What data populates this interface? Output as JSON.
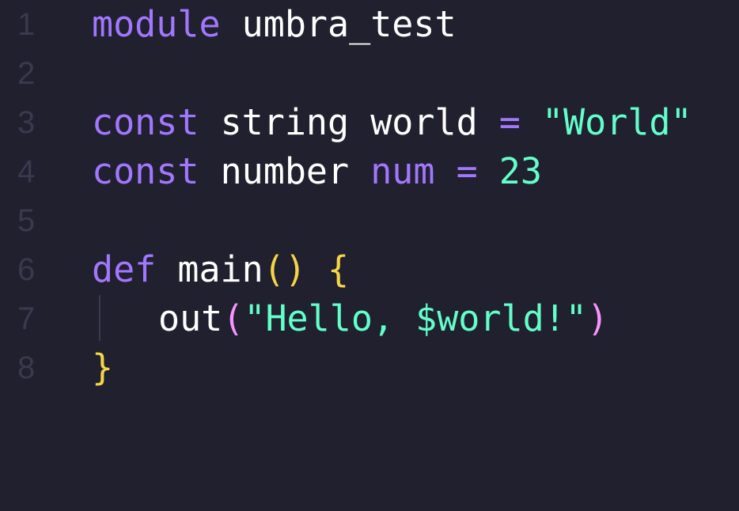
{
  "editor": {
    "theme": {
      "background": "#21202e",
      "keyword": "#a277ff",
      "string": "#61ffca",
      "text": "#ffffff",
      "gutter": "#3a394d",
      "bracket_outer": "#f5d547",
      "bracket_inner": "#f694ff"
    },
    "lines": [
      {
        "num": "1",
        "tokens": [
          "module",
          " ",
          "umbra_test"
        ]
      },
      {
        "num": "2",
        "tokens": []
      },
      {
        "num": "3",
        "tokens": [
          "const",
          " ",
          "string",
          " ",
          "world",
          " ",
          "=",
          " ",
          "\"World\""
        ]
      },
      {
        "num": "4",
        "tokens": [
          "const",
          " ",
          "number",
          " ",
          "num",
          " ",
          "=",
          " ",
          "23"
        ]
      },
      {
        "num": "5",
        "tokens": []
      },
      {
        "num": "6",
        "tokens": [
          "def",
          " ",
          "main",
          "(",
          ")",
          " ",
          "{"
        ]
      },
      {
        "num": "7",
        "tokens": [
          "out",
          "(",
          "\"Hello, $world!\"",
          ")"
        ]
      },
      {
        "num": "8",
        "tokens": [
          "}"
        ]
      }
    ]
  }
}
